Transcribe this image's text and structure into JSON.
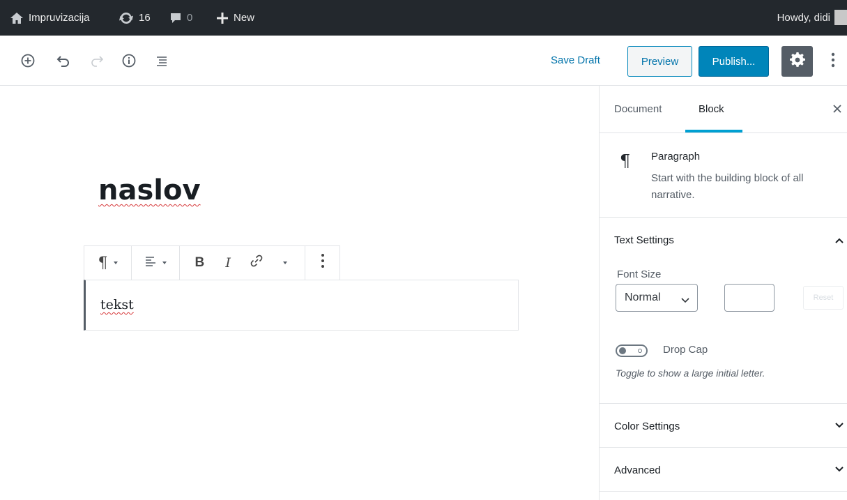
{
  "admin_bar": {
    "site_name": "Impruvizacija",
    "updates_count": "16",
    "comments_count": "0",
    "new_label": "New",
    "howdy": "Howdy, didi"
  },
  "toolbar": {
    "save_draft": "Save Draft",
    "preview": "Preview",
    "publish": "Publish...",
    "icons": [
      "add-block-icon",
      "undo-icon",
      "redo-icon",
      "info-icon",
      "outline-icon",
      "gear-icon",
      "more-vertical-icon"
    ]
  },
  "content": {
    "title": "naslov",
    "paragraph": "tekst"
  },
  "block_toolbar": {
    "icons": [
      "paragraph-icon",
      "align-left-icon",
      "bold-icon",
      "italic-icon",
      "link-icon",
      "more-rich-text-icon",
      "more-vertical-icon"
    ],
    "bold": "B",
    "italic": "I"
  },
  "sidebar": {
    "tabs": [
      {
        "label": "Document",
        "active": false
      },
      {
        "label": "Block",
        "active": true
      }
    ],
    "block_card": {
      "title": "Paragraph",
      "description": "Start with the building block of all narrative."
    },
    "text_settings": {
      "title": "Text Settings",
      "font_size_label": "Font Size",
      "font_size_value": "Normal",
      "custom_size_value": "",
      "reset_label": "Reset",
      "drop_cap_label": "Drop Cap",
      "drop_cap_help": "Toggle to show a large initial letter.",
      "drop_cap_enabled": false
    },
    "color_settings": {
      "title": "Color Settings"
    },
    "advanced": {
      "title": "Advanced"
    }
  },
  "colors": {
    "admin_bar_bg": "#23282d",
    "accent": "#0085ba",
    "tab_indicator": "#00a0d2"
  }
}
